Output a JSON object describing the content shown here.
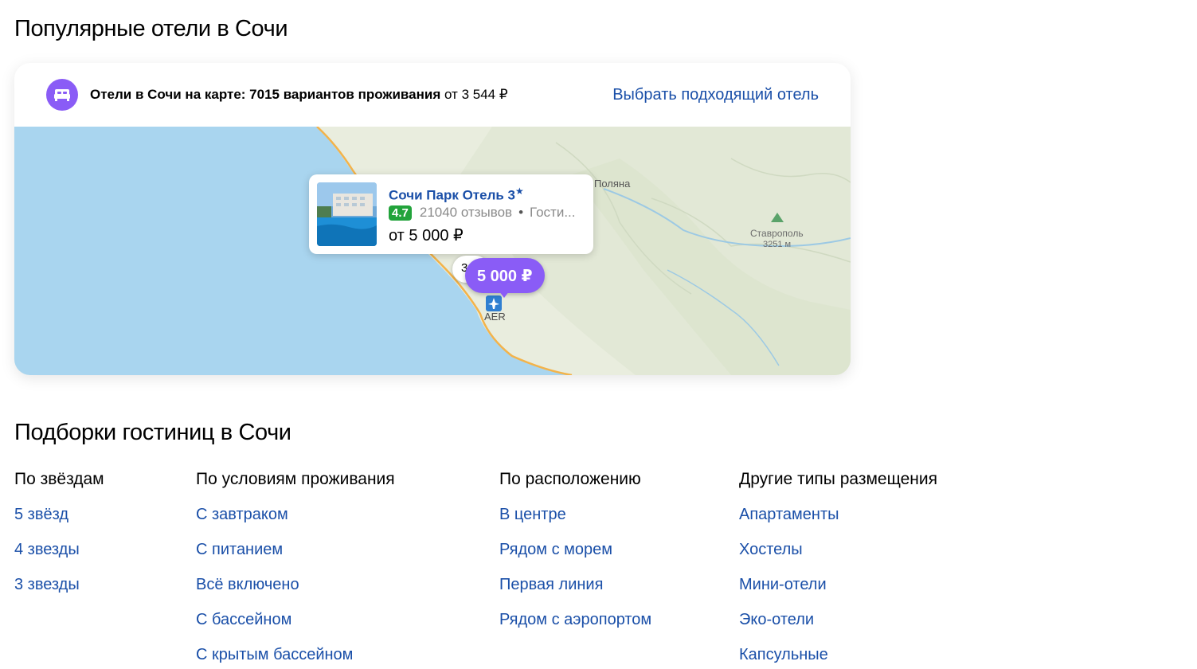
{
  "popular": {
    "title": "Популярные отели в Сочи",
    "summary_bold": "Отели в Сочи на карте: 7015 вариантов проживания",
    "summary_from": " от 3 544 ₽",
    "cta": "Выбрать подходящий отель"
  },
  "map": {
    "label_polyana": "Поляна",
    "label_stavropol": "Ставрополь",
    "label_stavropol_height": "3251 м",
    "label_airport": "AER",
    "small_pin_text": "3",
    "price_pin": "5 000 ₽"
  },
  "hotel": {
    "name": "Сочи Парк Отель 3",
    "rating": "4.7",
    "reviews": "21040 отзывов",
    "type": "Гости...",
    "price": "от 5 000 ₽"
  },
  "collections": {
    "title": "Подборки гостиниц в Сочи",
    "columns": [
      {
        "title": "По звёздам",
        "links": [
          "5 звёзд",
          "4 звезды",
          "3 звезды"
        ]
      },
      {
        "title": "По условиям проживания",
        "links": [
          "С завтраком",
          "С питанием",
          "Всё включено",
          "С бассейном",
          "С крытым бассейном"
        ]
      },
      {
        "title": "По расположению",
        "links": [
          "В центре",
          "Рядом с морем",
          "Первая линия",
          "Рядом с аэропортом"
        ]
      },
      {
        "title": "Другие типы размещения",
        "links": [
          "Апартаменты",
          "Хостелы",
          "Мини-отели",
          "Эко-отели",
          "Капсульные"
        ]
      }
    ]
  },
  "colors": {
    "accent": "#8a5cf6",
    "link": "#1a4fa8",
    "rating": "#22a33b",
    "sea": "#a9d5ef",
    "land": "#e8ecdc"
  }
}
